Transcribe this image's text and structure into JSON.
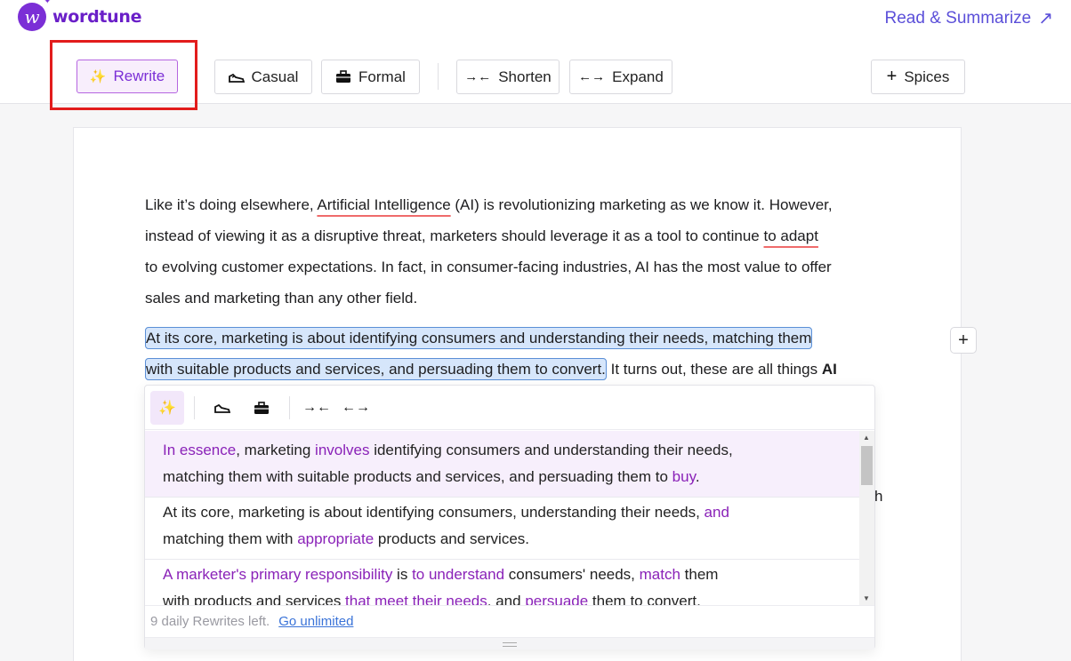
{
  "app": {
    "name": "wordtune",
    "read_link": "Read & Summarize"
  },
  "toolbar": {
    "rewrite": "Rewrite",
    "casual": "Casual",
    "formal": "Formal",
    "shorten": "Shorten",
    "expand": "Expand",
    "spices": "Spices"
  },
  "document": {
    "p1_line1_a": "Like it’s doing elsewhere, ",
    "p1_underline1": "Artificial Intelligence",
    "p1_line1_b": " (AI) is revolutionizing marketing as we know it. However,",
    "p1_line2_a": "instead of viewing it as a disruptive threat, marketers should leverage it as a tool to continue ",
    "p1_underline2": "to adapt",
    "p1_line3": "to evolving customer expectations. In fact, in consumer-facing industries, AI has the most value to offer",
    "p1_line4": "sales and marketing than any other field.",
    "p2_selected_line1": "At its core, marketing is about identifying consumers and understanding their needs, matching them",
    "p2_selected_line2": "with suitable products and services, and persuading them to convert.",
    "p2_after": " It turns out, these are all things ",
    "p2_bold": "AI",
    "stray_char": "h"
  },
  "popup": {
    "suggestions": [
      {
        "line1": [
          {
            "t": "In essence",
            "c": true
          },
          {
            "t": ", marketing ",
            "c": false
          },
          {
            "t": "involves",
            "c": true
          },
          {
            "t": " identifying consumers and understanding their needs,",
            "c": false
          }
        ],
        "line2": [
          {
            "t": "matching them with suitable products and services, and persuading them to ",
            "c": false
          },
          {
            "t": "buy",
            "c": true
          },
          {
            "t": ".",
            "c": false
          }
        ]
      },
      {
        "line1": [
          {
            "t": "At its core, marketing is about identifying consumers, understanding their needs, ",
            "c": false
          },
          {
            "t": "and",
            "c": true
          }
        ],
        "line2": [
          {
            "t": "matching them with ",
            "c": false
          },
          {
            "t": "appropriate",
            "c": true
          },
          {
            "t": " products and services.",
            "c": false
          }
        ]
      },
      {
        "line1": [
          {
            "t": "A marketer's primary responsibility",
            "c": true
          },
          {
            "t": " is ",
            "c": false
          },
          {
            "t": "to understand",
            "c": true
          },
          {
            "t": " consumers' needs, ",
            "c": false
          },
          {
            "t": "match",
            "c": true
          },
          {
            "t": " them",
            "c": false
          }
        ],
        "line2": [
          {
            "t": "with products and services ",
            "c": false
          },
          {
            "t": "that meet their needs",
            "c": true
          },
          {
            "t": ", and ",
            "c": false
          },
          {
            "t": "persuade",
            "c": true
          },
          {
            "t": " them to convert.",
            "c": false
          }
        ]
      }
    ],
    "footer_note": "9 daily Rewrites left.",
    "footer_link": "Go unlimited"
  },
  "icons": {
    "rewrite": "sparkle-icon",
    "casual": "sneaker-icon",
    "formal": "briefcase-icon",
    "shorten": "compress-arrows-icon",
    "expand": "expand-arrows-icon",
    "spices": "plus-icon"
  },
  "colors": {
    "brand": "#7b2fd6",
    "change": "#8a22b8",
    "link": "#3a73d8",
    "highlight_box": "#e21c1c"
  }
}
